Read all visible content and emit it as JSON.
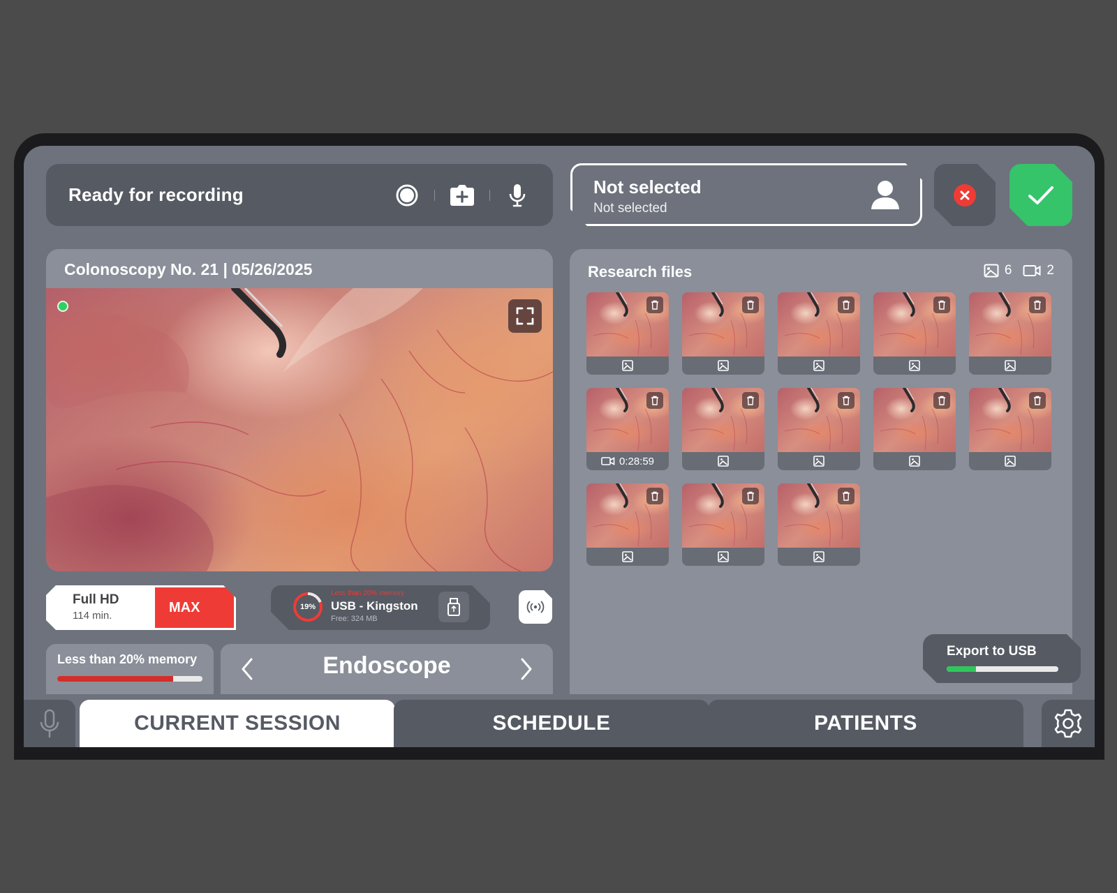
{
  "header": {
    "status": "Ready for recording",
    "icons": [
      "record-icon",
      "camera-add-icon",
      "microphone-icon"
    ]
  },
  "patient": {
    "name": "Not selected",
    "subtitle": "Not selected"
  },
  "video": {
    "title": "Colonoscopy No. 21 | 05/26/2025"
  },
  "quality": {
    "resolution": "Full HD",
    "duration": "114 min.",
    "level": "MAX"
  },
  "storage": {
    "percent_label": "19%",
    "percent": 19,
    "warning": "Less than 20% memory",
    "name": "USB - Kingston",
    "free": "Free: 324 MB"
  },
  "memory": {
    "label": "Less than 20% memory",
    "bar_fraction": 0.8
  },
  "device": {
    "name": "Endoscope"
  },
  "files": {
    "title": "Research files",
    "image_count": "6",
    "video_count": "2",
    "items": [
      {
        "type": "image",
        "label": ""
      },
      {
        "type": "image",
        "label": ""
      },
      {
        "type": "image",
        "label": ""
      },
      {
        "type": "image",
        "label": ""
      },
      {
        "type": "image",
        "label": ""
      },
      {
        "type": "video",
        "label": "0:28:59"
      },
      {
        "type": "image",
        "label": ""
      },
      {
        "type": "image",
        "label": ""
      },
      {
        "type": "image",
        "label": ""
      },
      {
        "type": "image",
        "label": ""
      },
      {
        "type": "image",
        "label": ""
      },
      {
        "type": "image",
        "label": ""
      },
      {
        "type": "image",
        "label": ""
      }
    ]
  },
  "export": {
    "label": "Export to USB",
    "progress_fraction": 0.26
  },
  "nav": {
    "tabs": [
      "CURRENT SESSION",
      "SCHEDULE",
      "PATIENTS"
    ],
    "active": 0
  },
  "colors": {
    "background": "#4b4b4b",
    "screen": "#6d727d",
    "panel_dark": "#555a63",
    "panel_light": "#8a8f99",
    "accent_green": "#35c46a",
    "accent_red": "#ef3b36"
  }
}
